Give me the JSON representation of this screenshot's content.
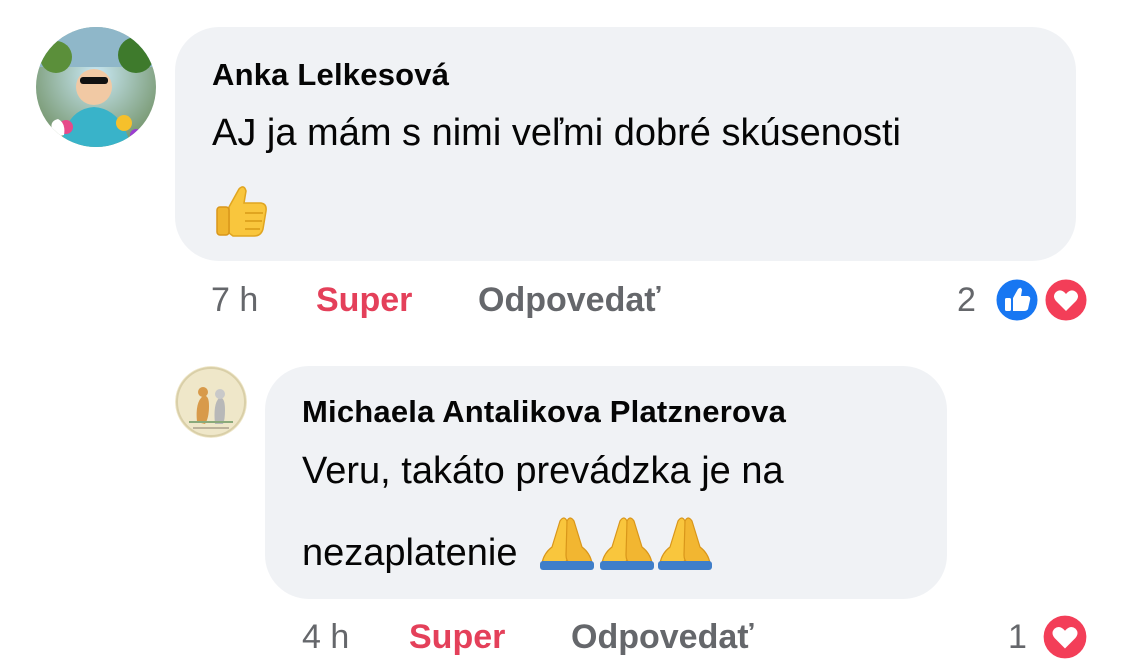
{
  "comments": [
    {
      "author": "Anka Lelkesová",
      "text": "AJ ja mám s nimi veľmi dobré skúsenosti",
      "emoji": "thumbs-up",
      "time": "7 h",
      "reaction_label": "Super",
      "reply_label": "Odpovedať",
      "reaction_count": "2",
      "reaction_icons": [
        "like-icon",
        "love-icon"
      ]
    },
    {
      "author": "Michaela Antalikova Platznerova",
      "text_line1": "Veru, takáto prevádzka je na",
      "text_line2": "nezaplatenie",
      "emoji": "folded-hands x3",
      "time": "4 h",
      "reaction_label": "Super",
      "reply_label": "Odpovedať",
      "reaction_count": "1",
      "reaction_icons": [
        "love-icon"
      ]
    }
  ],
  "colors": {
    "bubble": "#f0f2f5",
    "meta": "#65676b",
    "super": "#e4405a",
    "like": "#1877f2",
    "love": "#f33e58"
  }
}
